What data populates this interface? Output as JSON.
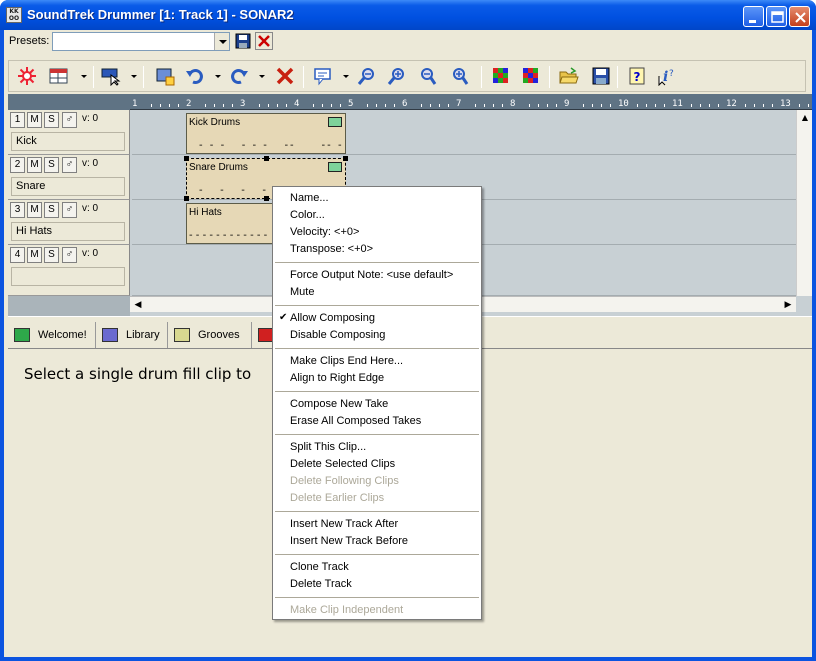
{
  "window": {
    "title": "SoundTrek Drummer [1: Track 1] - SONAR2",
    "controls": [
      "minimize",
      "maximize",
      "close"
    ]
  },
  "presets": {
    "label": "Presets:",
    "value": ""
  },
  "toolbar": {
    "icons": [
      "burst-icon",
      "grid-window-icon",
      "cursor-select-icon",
      "add-clip-icon",
      "undo-icon",
      "redo-icon",
      "delete-x-icon",
      "comment-icon",
      "zoom-out-h-icon",
      "zoom-in-h-icon",
      "zoom-out-v-icon",
      "zoom-in-v-icon",
      "color-grid-icon",
      "color-grid-2-icon",
      "open-folder-icon",
      "save-disk-icon",
      "help-icon",
      "whats-this-icon"
    ]
  },
  "ruler": {
    "marks": [
      "1",
      "2",
      "3",
      "4",
      "5",
      "6",
      "7",
      "8",
      "9",
      "10",
      "11",
      "12",
      "13"
    ]
  },
  "tracks": [
    {
      "num": "1",
      "m": "M",
      "s": "S",
      "vol": "v: 0",
      "name": "Kick"
    },
    {
      "num": "2",
      "m": "M",
      "s": "S",
      "vol": "v: 0",
      "name": "Snare"
    },
    {
      "num": "3",
      "m": "M",
      "s": "S",
      "vol": "v: 0",
      "name": "Hi Hats"
    },
    {
      "num": "4",
      "m": "M",
      "s": "S",
      "vol": "v: 0",
      "name": ""
    }
  ],
  "clips": [
    {
      "name": "Kick Drums",
      "pattern": "- - -   - - -   --     -- -"
    },
    {
      "name": "Snare Drums",
      "pattern": "-   -   -   -"
    },
    {
      "name": "Hi Hats",
      "pattern": "- - - - - - - - - - - -"
    }
  ],
  "tabs": [
    {
      "label": "Welcome!",
      "color": "#2ea84a"
    },
    {
      "label": "Library",
      "color": "#6a6ad0"
    },
    {
      "label": "Grooves",
      "color": "#d8d890"
    },
    {
      "label": "",
      "color": "#d02020"
    }
  ],
  "hint_text": "Select a single drum fill clip to",
  "context_menu": {
    "groups": [
      [
        {
          "label": "Name...",
          "enabled": true
        },
        {
          "label": "Color...",
          "enabled": true
        },
        {
          "label": "Velocity: <+0>",
          "enabled": true
        },
        {
          "label": "Transpose: <+0>",
          "enabled": true
        }
      ],
      [
        {
          "label": "Force Output Note: <use default>",
          "enabled": true
        },
        {
          "label": "Mute",
          "enabled": true
        }
      ],
      [
        {
          "label": "Allow Composing",
          "enabled": true,
          "checked": true
        },
        {
          "label": "Disable Composing",
          "enabled": true
        }
      ],
      [
        {
          "label": "Make Clips End Here...",
          "enabled": true
        },
        {
          "label": "Align to Right Edge",
          "enabled": true
        }
      ],
      [
        {
          "label": "Compose New Take",
          "enabled": true
        },
        {
          "label": "Erase All Composed Takes",
          "enabled": true
        }
      ],
      [
        {
          "label": "Split This Clip...",
          "enabled": true
        },
        {
          "label": "Delete Selected Clips",
          "enabled": true
        },
        {
          "label": "Delete Following Clips",
          "enabled": false
        },
        {
          "label": "Delete Earlier Clips",
          "enabled": false
        }
      ],
      [
        {
          "label": "Insert New Track After",
          "enabled": true
        },
        {
          "label": "Insert New Track Before",
          "enabled": true
        }
      ],
      [
        {
          "label": "Clone Track",
          "enabled": true
        },
        {
          "label": "Delete Track",
          "enabled": true
        }
      ],
      [
        {
          "label": "Make Clip Independent",
          "enabled": false
        }
      ]
    ]
  }
}
